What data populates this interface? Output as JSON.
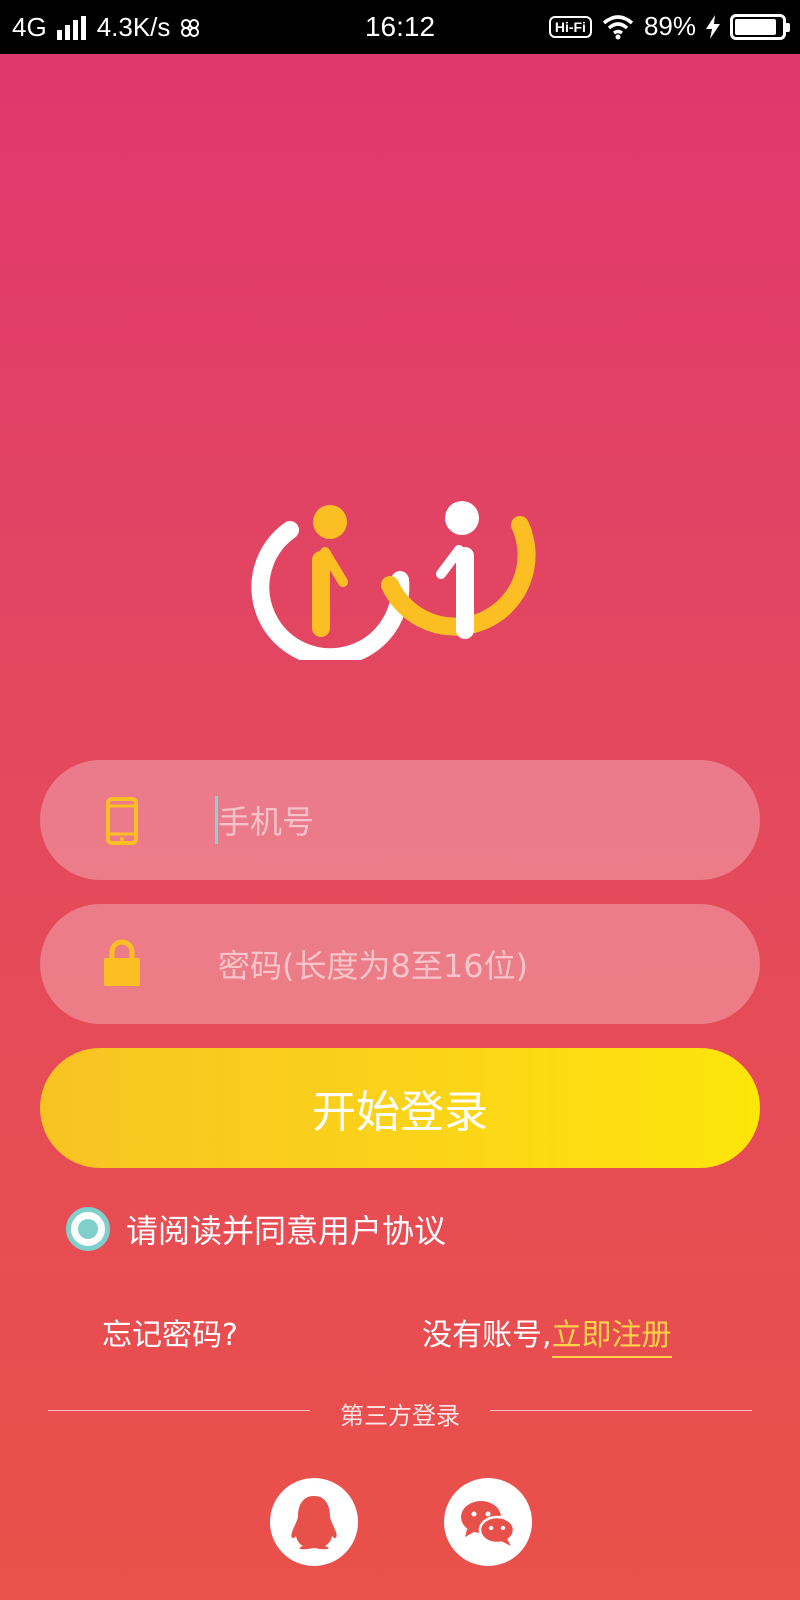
{
  "status_bar": {
    "network": "4G",
    "speed": "4.3K/s",
    "time": "16:12",
    "hifi": "Hi-Fi",
    "battery_percent": "89%",
    "battery_level": 0.89
  },
  "login": {
    "phone_placeholder": "手机号",
    "password_placeholder": "密码(长度为8至16位)",
    "login_button": "开始登录",
    "agreement": "请阅读并同意用户协议",
    "forgot_password": "忘记密码?",
    "no_account": "没有账号,",
    "register": "立即注册",
    "third_party_label": "第三方登录"
  },
  "icons": {
    "phone": "mobile-phone-icon",
    "lock": "lock-icon",
    "qq": "qq-penguin-icon",
    "wechat": "wechat-icon"
  },
  "colors": {
    "accent_yellow": "#fbd21a",
    "teal": "#7fd0cc",
    "gradient_top": "#e0366f",
    "gradient_bottom": "#ea5149"
  }
}
